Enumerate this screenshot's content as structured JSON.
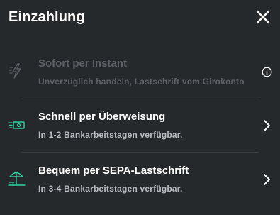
{
  "header": {
    "title": "Einzahlung"
  },
  "options": [
    {
      "title": "Sofort per Instant",
      "subtitle": "Unverzüglich handeln, Lastschrift vom Girokonto",
      "icon": "lightning-icon",
      "enabled": false,
      "action_icon": "info-icon"
    },
    {
      "title": "Schnell per Überweisung",
      "subtitle": "In 1-2 Bankarbeitstagen verfügbar.",
      "icon": "banknote-icon",
      "enabled": true,
      "action_icon": "chevron-right-icon"
    },
    {
      "title": "Bequem per SEPA-Lastschrift",
      "subtitle": "In 3-4 Bankarbeitstagen verfügbar.",
      "icon": "beach-umbrella-icon",
      "enabled": true,
      "action_icon": "chevron-right-icon"
    }
  ],
  "colors": {
    "background": "#26292c",
    "accent": "#2ecfa0",
    "text": "#ffffff",
    "subtext": "#b8bcc0",
    "disabled": "#5d6165",
    "divider": "#3b3f43"
  }
}
